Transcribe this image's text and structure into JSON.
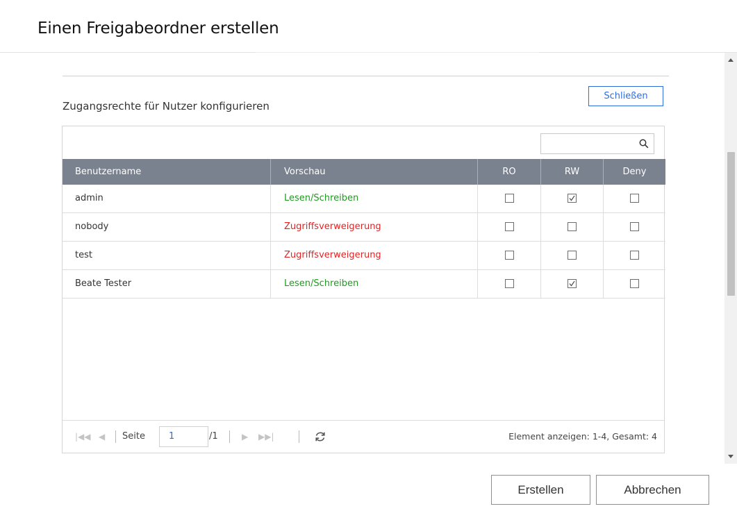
{
  "dialog": {
    "title": "Einen Freigabeordner erstellen"
  },
  "section": {
    "label": "Zugangsrechte für Nutzer konfigurieren",
    "close_label": "Schließen"
  },
  "search": {
    "placeholder": "",
    "icon": "search-icon"
  },
  "table": {
    "headers": {
      "user": "Benutzername",
      "preview": "Vorschau",
      "ro": "RO",
      "rw": "RW",
      "deny": "Deny"
    },
    "rows": [
      {
        "user": "admin",
        "preview": "Lesen/Schreiben",
        "ro": false,
        "rw": true,
        "deny": false
      },
      {
        "user": "nobody",
        "preview": "Zugriffsverweigerung",
        "ro": false,
        "rw": false,
        "deny": false
      },
      {
        "user": "test",
        "preview": "Zugriffsverweigerung",
        "ro": false,
        "rw": false,
        "deny": false
      },
      {
        "user": "Beate Tester",
        "preview": "Lesen/Schreiben",
        "ro": false,
        "rw": true,
        "deny": false
      }
    ]
  },
  "pager": {
    "page_label": "Seite",
    "page_value": "1",
    "total_pages": "/1",
    "summary": "Element anzeigen: 1-4, Gesamt: 4"
  },
  "footer": {
    "create_label": "Erstellen",
    "cancel_label": "Abbrechen"
  },
  "colors": {
    "accent": "#2d6cdf",
    "header_bg": "#7a8290",
    "allow": "#1f9a1f",
    "deny": "#e02424"
  }
}
